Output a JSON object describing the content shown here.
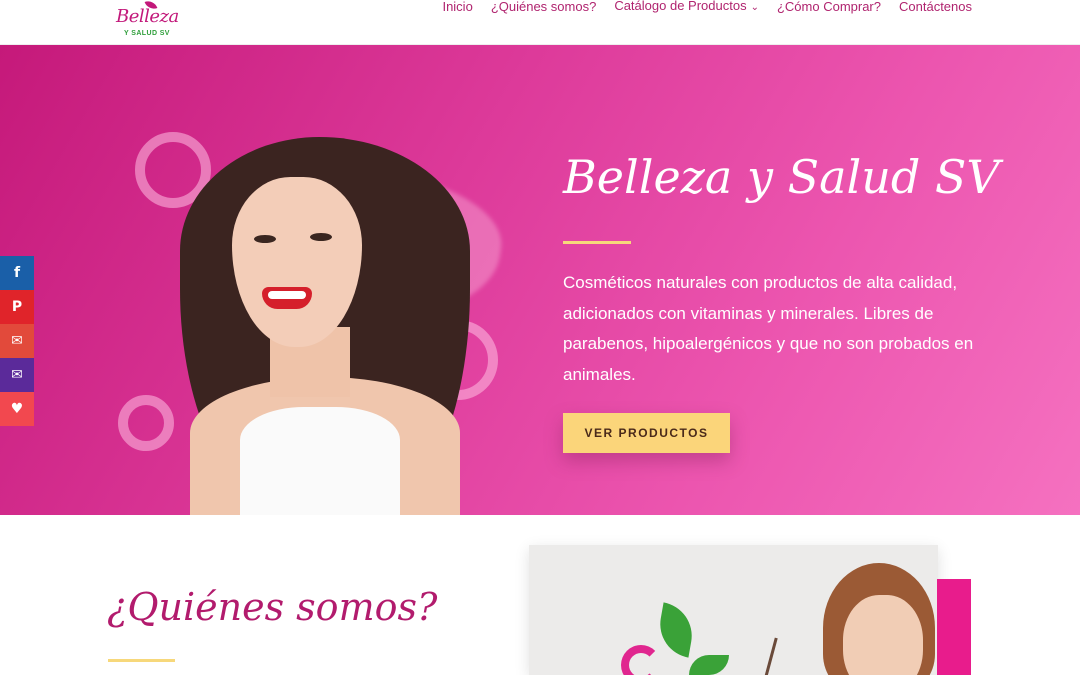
{
  "brand": {
    "logo_script": "Belleza",
    "logo_sub": "Y SALUD SV"
  },
  "nav": {
    "items": [
      {
        "label": "Inicio"
      },
      {
        "label": "¿Quiénes somos?"
      },
      {
        "label": "Catálogo de Productos",
        "has_dropdown": true
      },
      {
        "label": "¿Cómo Comprar?"
      },
      {
        "label": "Contáctenos"
      }
    ]
  },
  "hero": {
    "title": "Belleza y Salud SV",
    "description": "Cosméticos naturales con productos de alta calidad, adicionados con vitaminas y minerales. Libres de parabenos, hipoalergénicos y que no son probados en animales.",
    "button_label": "VER PRODUCTOS"
  },
  "share": {
    "buttons": [
      {
        "icon": "facebook-icon",
        "glyph": "f",
        "color": "#1a5fa8"
      },
      {
        "icon": "pinterest-icon",
        "glyph": "P",
        "color": "#e0242a"
      },
      {
        "icon": "gmail-icon",
        "glyph": "✉",
        "color": "#e24a3b"
      },
      {
        "icon": "email-icon",
        "glyph": "✉",
        "color": "#5b2a9a"
      },
      {
        "icon": "favorite-icon",
        "glyph": "♥",
        "color": "#f2484f"
      }
    ]
  },
  "about": {
    "title": "¿Quiénes somos?"
  },
  "colors": {
    "brand_pink": "#c2187a",
    "accent_gold": "#fbd57a",
    "accent_magenta": "#e81c8c"
  }
}
